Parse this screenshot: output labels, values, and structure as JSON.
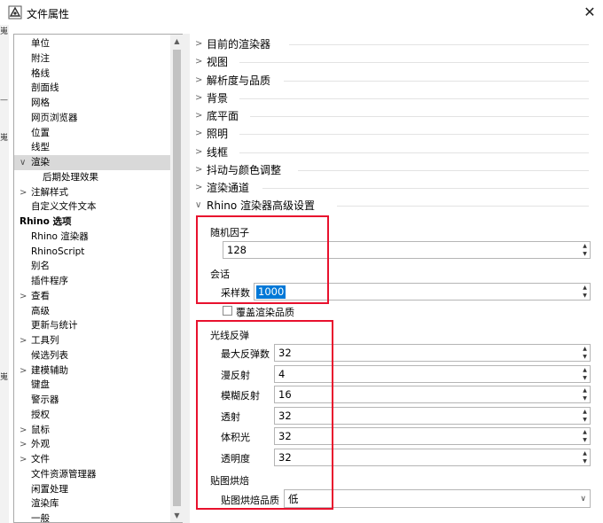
{
  "window": {
    "title": "文件属性",
    "close_glyph": "✕"
  },
  "left_frame": {
    "bits": [
      "嵬",
      "—",
      "嵬",
      "嵬"
    ]
  },
  "tree": {
    "items": [
      {
        "label": "单位",
        "level": 1,
        "arrow": ""
      },
      {
        "label": "附注",
        "level": 1,
        "arrow": ""
      },
      {
        "label": "格线",
        "level": 1,
        "arrow": ""
      },
      {
        "label": "剖面线",
        "level": 1,
        "arrow": ""
      },
      {
        "label": "网格",
        "level": 1,
        "arrow": ""
      },
      {
        "label": "网页浏览器",
        "level": 1,
        "arrow": ""
      },
      {
        "label": "位置",
        "level": 1,
        "arrow": ""
      },
      {
        "label": "线型",
        "level": 1,
        "arrow": ""
      },
      {
        "label": "渲染",
        "level": 1,
        "arrow": "∨",
        "selected": true
      },
      {
        "label": "后期处理效果",
        "level": 2,
        "arrow": ""
      },
      {
        "label": "注解样式",
        "level": 1,
        "arrow": ">"
      },
      {
        "label": "自定义文件文本",
        "level": 1,
        "arrow": ""
      },
      {
        "label": "Rhino 选项",
        "level": 0,
        "arrow": "",
        "bold": true
      },
      {
        "label": "Rhino 渲染器",
        "level": 1,
        "arrow": ""
      },
      {
        "label": "RhinoScript",
        "level": 1,
        "arrow": ""
      },
      {
        "label": "别名",
        "level": 1,
        "arrow": ""
      },
      {
        "label": "插件程序",
        "level": 1,
        "arrow": ""
      },
      {
        "label": "查看",
        "level": 1,
        "arrow": ">"
      },
      {
        "label": "高级",
        "level": 1,
        "arrow": ""
      },
      {
        "label": "更新与统计",
        "level": 1,
        "arrow": ""
      },
      {
        "label": "工具列",
        "level": 1,
        "arrow": ">"
      },
      {
        "label": "候选列表",
        "level": 1,
        "arrow": ""
      },
      {
        "label": "建模辅助",
        "level": 1,
        "arrow": ">"
      },
      {
        "label": "键盘",
        "level": 1,
        "arrow": ""
      },
      {
        "label": "警示器",
        "level": 1,
        "arrow": ""
      },
      {
        "label": "授权",
        "level": 1,
        "arrow": ""
      },
      {
        "label": "鼠标",
        "level": 1,
        "arrow": ">"
      },
      {
        "label": "外观",
        "level": 1,
        "arrow": ">"
      },
      {
        "label": "文件",
        "level": 1,
        "arrow": ">"
      },
      {
        "label": "文件资源管理器",
        "level": 1,
        "arrow": ""
      },
      {
        "label": "闲置处理",
        "level": 1,
        "arrow": ""
      },
      {
        "label": "渲染库",
        "level": 1,
        "arrow": ""
      },
      {
        "label": "一般",
        "level": 1,
        "arrow": ""
      }
    ],
    "scroll_up": "▲",
    "scroll_down": "▼"
  },
  "sections": [
    {
      "label": "目前的渲染器",
      "arrow": ">"
    },
    {
      "label": "视图",
      "arrow": ">"
    },
    {
      "label": "解析度与品质",
      "arrow": ">"
    },
    {
      "label": "背景",
      "arrow": ">"
    },
    {
      "label": "底平面",
      "arrow": ">"
    },
    {
      "label": "照明",
      "arrow": ">"
    },
    {
      "label": "线框",
      "arrow": ">"
    },
    {
      "label": "抖动与颜色调整",
      "arrow": ">"
    },
    {
      "label": "渲染通道",
      "arrow": ">"
    },
    {
      "label": "Rhino 渲染器高级设置",
      "arrow": "∨"
    }
  ],
  "advanced": {
    "random_seed": {
      "label": "随机因子",
      "value": "128"
    },
    "session": {
      "label": "会话",
      "samples_label": "采样数",
      "samples_value": "1000",
      "override_label": "覆盖渲染品质",
      "override_checked": false
    },
    "ray_bounces": {
      "label": "光线反弹",
      "fields": [
        {
          "label": "最大反弹数",
          "value": "32"
        },
        {
          "label": "漫反射",
          "value": "4"
        },
        {
          "label": "模糊反射",
          "value": "16"
        },
        {
          "label": "透射",
          "value": "32"
        },
        {
          "label": "体积光",
          "value": "32"
        },
        {
          "label": "透明度",
          "value": "32"
        }
      ]
    },
    "texture_baking": {
      "label": "贴图烘焙",
      "quality_label": "贴图烘焙品质",
      "quality_value": "低"
    }
  },
  "spin_glyphs": {
    "up": "▲",
    "down": "▼",
    "chevron": "∨"
  },
  "colors": {
    "highlight_box": "#e8112d",
    "selection": "#0078d7",
    "tree_selected": "#d9d9d9"
  }
}
